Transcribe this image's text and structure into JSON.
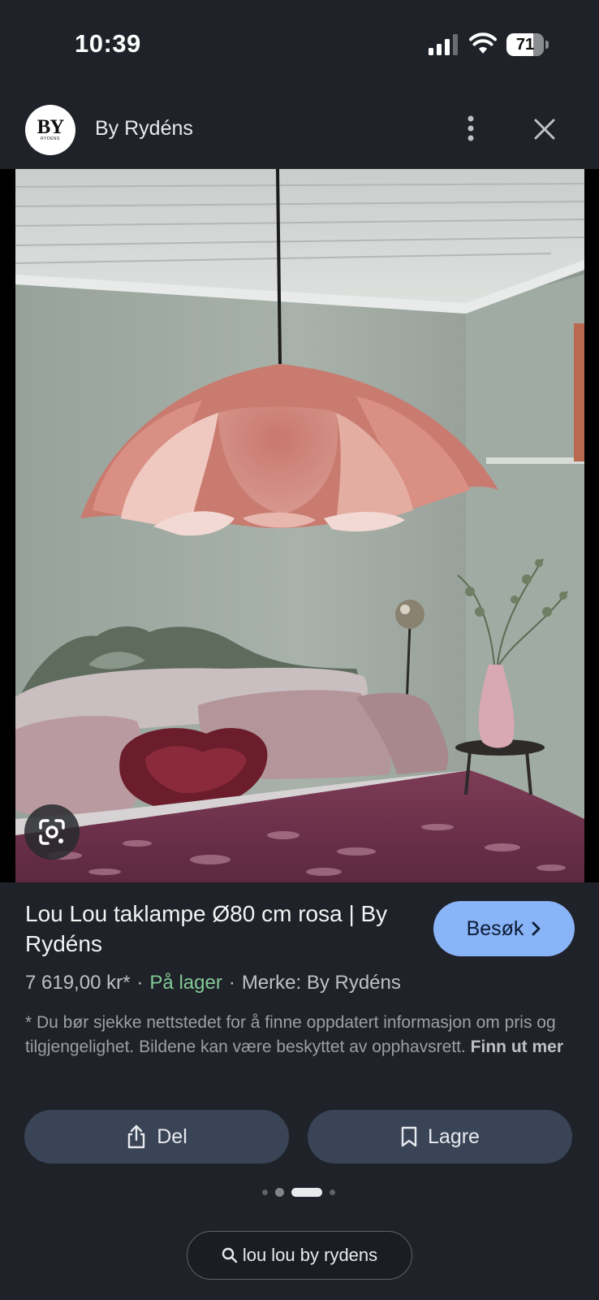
{
  "status_bar": {
    "time": "10:39",
    "battery_level": "71",
    "battery_fraction": 0.71
  },
  "header": {
    "logo_text": "BY",
    "logo_subtext": "RYDÉNS",
    "site_name": "By Rydéns",
    "more_icon": "more-vertical-icon",
    "close_icon": "close-icon"
  },
  "image": {
    "lens_icon": "google-lens-icon"
  },
  "product": {
    "title": "Lou Lou taklampe Ø80 cm rosa | By Rydéns",
    "price": "7 619,00 kr*",
    "availability": "På lager",
    "brand": "Merke: By Rydéns",
    "separator": "·",
    "disclaimer": "* Du bør sjekke nettstedet for å finne oppdatert informasjon om pris og tilgjengelighet. Bildene kan være beskyttet av opphavsrett.",
    "learn_more": "Finn ut mer"
  },
  "buttons": {
    "visit_label": "Besøk",
    "share_label": "Del",
    "save_label": "Lagre"
  },
  "pager": {
    "total": 4,
    "active_index": 2
  },
  "search": {
    "query": "lou lou by rydens"
  },
  "colors": {
    "background": "#202229",
    "accent": "#8ab4f8",
    "in_stock": "#81c995",
    "button_bg": "#394457"
  }
}
